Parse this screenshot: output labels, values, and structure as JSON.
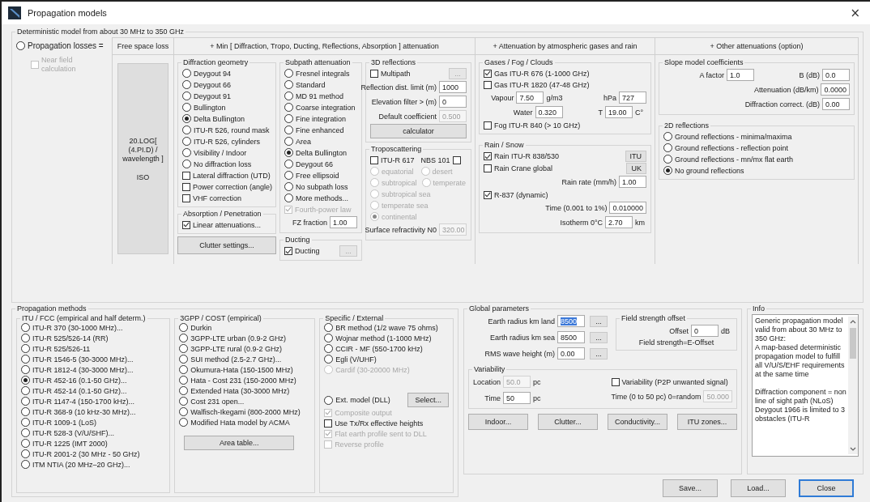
{
  "window": {
    "title": "Propagation models",
    "close": "×"
  },
  "deterministic": {
    "title": "Deterministic model from about 30 MHz to 350 GHz",
    "losses": {
      "kind": "radio",
      "label": "Propagation losses =",
      "selected": false
    },
    "near_field": {
      "kind": "check",
      "label": "Near field calculation",
      "checked": false,
      "disabled": true
    },
    "columns": [
      {
        "kind": "formula",
        "header": "Free space loss",
        "formula": "20.LOG[ (4.PI.D) / wavelength ]",
        "note": "ISO"
      },
      {
        "kind": "stacks",
        "header": "+ Min [ Diffraction, Tropo, Ducting, Reflections, Absorption ] attenuation",
        "stacks": [
          [
            {
              "kind": "group",
              "title": "Diffraction geometry",
              "items": [
                {
                  "kind": "radio",
                  "label": "Deygout 94",
                  "selected": false
                },
                {
                  "kind": "radio",
                  "label": "Deygout 66",
                  "selected": false
                },
                {
                  "kind": "radio",
                  "label": "Deygout 91",
                  "selected": false
                },
                {
                  "kind": "radio",
                  "label": "Bullington",
                  "selected": false
                },
                {
                  "kind": "radio",
                  "label": "Delta Bullington",
                  "selected": true
                },
                {
                  "kind": "radio",
                  "label": "ITU-R 526, round mask",
                  "selected": false
                },
                {
                  "kind": "radio",
                  "label": "ITU-R 526, cylinders",
                  "selected": false
                },
                {
                  "kind": "radio",
                  "label": "Visibility / Indoor",
                  "selected": false
                },
                {
                  "kind": "radio",
                  "label": "No diffraction loss",
                  "selected": false
                },
                {
                  "kind": "check",
                  "label": "Lateral diffraction (UTD)",
                  "checked": false
                },
                {
                  "kind": "check",
                  "label": "Power correction (angle)",
                  "checked": false
                },
                {
                  "kind": "check",
                  "label": "VHF correction",
                  "checked": false
                }
              ]
            },
            {
              "kind": "group",
              "title": "Absorption / Penetration",
              "items": [
                {
                  "kind": "check",
                  "label": "Linear attenuations...",
                  "checked": true
                }
              ]
            },
            {
              "kind": "button",
              "label": "Clutter settings..."
            }
          ],
          [
            {
              "kind": "group",
              "title": "Subpath attenuation",
              "items": [
                {
                  "kind": "radio",
                  "label": "Fresnel integrals",
                  "selected": false,
                  "disabled": false
                },
                {
                  "kind": "radio",
                  "label": "Standard",
                  "selected": false,
                  "disabled": false
                },
                {
                  "kind": "radio",
                  "label": "MD 91 method",
                  "selected": false,
                  "disabled": false
                },
                {
                  "kind": "radio",
                  "label": "Coarse integration",
                  "selected": false,
                  "disabled": false
                },
                {
                  "kind": "radio",
                  "label": "Fine integration",
                  "selected": false,
                  "disabled": false
                },
                {
                  "kind": "radio",
                  "label": "Fine enhanced",
                  "selected": false,
                  "disabled": false
                },
                {
                  "kind": "radio",
                  "label": "Area",
                  "selected": false,
                  "disabled": false
                },
                {
                  "kind": "radio",
                  "label": "Delta Bullington",
                  "selected": true,
                  "disabled": false
                },
                {
                  "kind": "radio",
                  "label": "Deygout 66",
                  "selected": false,
                  "disabled": false
                },
                {
                  "kind": "radio",
                  "label": "Free ellipsoid",
                  "selected": false,
                  "disabled": false
                },
                {
                  "kind": "radio",
                  "label": "No subpath loss",
                  "selected": false,
                  "disabled": false
                },
                {
                  "kind": "radio",
                  "label": "More methods...",
                  "selected": false,
                  "disabled": false
                },
                {
                  "kind": "check",
                  "label": "Fourth-power law",
                  "checked": true,
                  "disabled": true
                },
                {
                  "kind": "field",
                  "label": "FZ fraction",
                  "value": "1.00",
                  "disabled": false
                }
              ]
            },
            {
              "kind": "group",
              "title": "Ducting",
              "items": [
                {
                  "kind": "row",
                  "items": [
                    {
                      "kind": "check",
                      "label": "Ducting",
                      "checked": true,
                      "disabled": false
                    },
                    {
                      "kind": "mini",
                      "label": "...",
                      "disabled": true
                    }
                  ]
                }
              ]
            }
          ],
          [
            {
              "kind": "group",
              "title": "3D reflections",
              "items": [
                {
                  "kind": "row",
                  "items": [
                    {
                      "kind": "check",
                      "label": "Multipath",
                      "checked": false,
                      "disabled": false
                    },
                    {
                      "kind": "mini",
                      "label": "...",
                      "disabled": true
                    }
                  ]
                },
                {
                  "kind": "field",
                  "label": "Reflection dist. limit (m)",
                  "value": "1000",
                  "disabled": false
                },
                {
                  "kind": "field",
                  "label": "Elevation filter > (m)",
                  "value": "0",
                  "disabled": false
                },
                {
                  "kind": "field",
                  "label": "Default coefficient",
                  "value": "0.500",
                  "disabled": true
                },
                {
                  "kind": "button",
                  "label": "calculator"
                }
              ]
            },
            {
              "kind": "group",
              "title": "Troposcattering",
              "items": [
                {
                  "kind": "row",
                  "items": [
                    {
                      "kind": "check",
                      "label": "ITU-R 617",
                      "checked": false,
                      "disabled": false
                    },
                    {
                      "kind": "check",
                      "label": "NBS 101",
                      "checked": false,
                      "disabled": false,
                      "label_first": true
                    }
                  ]
                },
                {
                  "kind": "row",
                  "items": [
                    {
                      "kind": "radio",
                      "label": "equatorial",
                      "selected": false,
                      "disabled": true
                    },
                    {
                      "kind": "radio",
                      "label": "desert",
                      "selected": false,
                      "disabled": true
                    }
                  ]
                },
                {
                  "kind": "row",
                  "items": [
                    {
                      "kind": "radio",
                      "label": "subtropical",
                      "selected": false,
                      "disabled": true
                    },
                    {
                      "kind": "radio",
                      "label": "temperate",
                      "selected": false,
                      "disabled": true
                    }
                  ]
                },
                {
                  "kind": "radio",
                  "label": "subtropical sea",
                  "selected": false,
                  "disabled": true
                },
                {
                  "kind": "radio",
                  "label": "temperate sea",
                  "selected": false,
                  "disabled": true
                },
                {
                  "kind": "radio",
                  "label": "continental",
                  "selected": true,
                  "disabled": true
                },
                {
                  "kind": "field",
                  "label": "Surface refractivity N0",
                  "value": "320.00",
                  "disabled": true
                }
              ]
            }
          ]
        ]
      },
      {
        "kind": "stacks",
        "header": "+ Attenuation by atmospheric gases and rain",
        "stacks": [
          [
            {
              "kind": "group",
              "title": "Gases / Fog / Clouds",
              "items": [
                {
                  "kind": "check",
                  "label": "Gas ITU-R 676 (1-1000 GHz)",
                  "checked": true
                },
                {
                  "kind": "check",
                  "label": "Gas ITU-R 1820 (47-48 GHz)",
                  "checked": false
                },
                {
                  "kind": "row",
                  "items": [
                    {
                      "kind": "field",
                      "label": "Vapour",
                      "value": "7.50",
                      "unit": "g/m3"
                    },
                    {
                      "kind": "field",
                      "label": "hPa",
                      "value": "727"
                    }
                  ]
                },
                {
                  "kind": "row",
                  "items": [
                    {
                      "kind": "field",
                      "label": "Water",
                      "value": "0.320"
                    },
                    {
                      "kind": "field",
                      "label": "T",
                      "value": "19.00",
                      "unit": "C°"
                    }
                  ]
                },
                {
                  "kind": "check",
                  "label": "Fog ITU-R 840 (> 10 GHz)",
                  "checked": false
                }
              ]
            },
            {
              "kind": "group",
              "title": "Rain / Snow",
              "items": [
                {
                  "kind": "row",
                  "items": [
                    {
                      "kind": "check",
                      "label": "Rain ITU-R 838/530",
                      "checked": true
                    },
                    {
                      "kind": "mini",
                      "label": "ITU"
                    }
                  ]
                },
                {
                  "kind": "row",
                  "items": [
                    {
                      "kind": "check",
                      "label": "Rain Crane global",
                      "checked": false
                    },
                    {
                      "kind": "mini",
                      "label": "UK"
                    }
                  ]
                },
                {
                  "kind": "field",
                  "label": "Rain rate (mm/h)",
                  "value": "1.00"
                },
                {
                  "kind": "row",
                  "items": [
                    {
                      "kind": "check",
                      "label": "R-837 (dynamic)",
                      "checked": true
                    }
                  ]
                },
                {
                  "kind": "field",
                  "label": "Time (0.001 to 1%)",
                  "value": "0.010000"
                },
                {
                  "kind": "field",
                  "label": "Isotherm 0°C",
                  "value": "2.70",
                  "unit": "km"
                }
              ]
            }
          ]
        ]
      },
      {
        "kind": "stacks",
        "header": "+ Other attenuations (option)",
        "stacks": [
          [
            {
              "kind": "group",
              "title": "Slope model coefficients",
              "items": [
                {
                  "kind": "row",
                  "items": [
                    {
                      "kind": "field",
                      "label": "A factor",
                      "value": "1.0"
                    },
                    {
                      "kind": "field",
                      "label": "B (dB)",
                      "value": "0.0"
                    }
                  ]
                },
                {
                  "kind": "field",
                  "label": "Attenuation (dB/km)",
                  "value": "0.0000"
                },
                {
                  "kind": "field",
                  "label": "Diffraction correct. (dB)",
                  "value": "0.00"
                }
              ]
            },
            {
              "kind": "group",
              "title": "2D reflections",
              "items": [
                {
                  "kind": "radio",
                  "label": "Ground reflections - minima/maxima",
                  "selected": false
                },
                {
                  "kind": "radio",
                  "label": "Ground reflections - reflection point",
                  "selected": false
                },
                {
                  "kind": "radio",
                  "label": "Ground reflections - mn/mx flat earth",
                  "selected": false
                },
                {
                  "kind": "radio",
                  "label": "No ground reflections",
                  "selected": true
                }
              ]
            }
          ]
        ]
      }
    ]
  },
  "methods": {
    "title": "Propagation methods",
    "groups": [
      {
        "kind": "group",
        "title": "ITU / FCC (empirical and half determ.)",
        "items": [
          {
            "kind": "radio",
            "label": "ITU-R 370 (30-1000 MHz)...",
            "selected": false
          },
          {
            "kind": "radio",
            "label": "ITU-R 525/526-14 (RR)",
            "selected": false
          },
          {
            "kind": "radio",
            "label": "ITU-R 525/526-11",
            "selected": false
          },
          {
            "kind": "radio",
            "label": "ITU-R 1546-5 (30-3000 MHz)...",
            "selected": false
          },
          {
            "kind": "radio",
            "label": "ITU-R 1812-4 (30-3000 MHz)...",
            "selected": false
          },
          {
            "kind": "radio",
            "label": "ITU-R 452-16 (0.1-50 GHz)...",
            "selected": true
          },
          {
            "kind": "radio",
            "label": "ITU-R 452-14 (0.1-50 GHz)...",
            "selected": false
          },
          {
            "kind": "radio",
            "label": "ITU-R 1147-4 (150-1700 kHz)...",
            "selected": false
          },
          {
            "kind": "radio",
            "label": "ITU-R 368-9 (10 kHz-30 MHz)...",
            "selected": false
          },
          {
            "kind": "radio",
            "label": "ITU-R 1009-1 (LoS)",
            "selected": false
          },
          {
            "kind": "radio",
            "label": "ITU-R 528-3 (V/U/SHF)...",
            "selected": false
          },
          {
            "kind": "radio",
            "label": "ITU-R 1225 (IMT 2000)",
            "selected": false
          },
          {
            "kind": "radio",
            "label": "ITU-R 2001-2 (30 MHz - 50 GHz)",
            "selected": false
          },
          {
            "kind": "radio",
            "label": "ITM NTIA (20 MHz–20 GHz)...",
            "selected": false
          }
        ]
      },
      {
        "kind": "group",
        "title": "3GPP / COST (empirical)",
        "items": [
          {
            "kind": "radio",
            "label": "Durkin",
            "selected": false
          },
          {
            "kind": "radio",
            "label": "3GPP-LTE urban (0.9-2 GHz)",
            "selected": false
          },
          {
            "kind": "radio",
            "label": "3GPP-LTE rural (0.9-2 GHz)",
            "selected": false
          },
          {
            "kind": "radio",
            "label": "SUI method (2.5-2.7 GHz)...",
            "selected": false
          },
          {
            "kind": "radio",
            "label": "Okumura-Hata (150-1500 MHz)",
            "selected": false
          },
          {
            "kind": "radio",
            "label": "Hata - Cost 231 (150-2000 MHz)",
            "selected": false
          },
          {
            "kind": "radio",
            "label": "Extended Hata (30-3000 MHz)",
            "selected": false
          },
          {
            "kind": "radio",
            "label": "Cost 231 open...",
            "selected": false
          },
          {
            "kind": "radio",
            "label": "Walfisch-Ikegami (800-2000 MHz)",
            "selected": false
          },
          {
            "kind": "radio",
            "label": "Modified Hata model by ACMA",
            "selected": false
          },
          {
            "kind": "button",
            "label": "Area table..."
          }
        ]
      },
      {
        "kind": "group",
        "title": "Specific / External",
        "items": [
          {
            "kind": "radio",
            "label": "BR method (1/2 wave 75 ohms)",
            "selected": false,
            "disabled": false
          },
          {
            "kind": "radio",
            "label": "Wojnar method (1-1000 MHz)",
            "selected": false,
            "disabled": false
          },
          {
            "kind": "radio",
            "label": "CCIR - MF (550-1700 kHz)",
            "selected": false,
            "disabled": false
          },
          {
            "kind": "radio",
            "label": "Egli (V/UHF)",
            "selected": false,
            "disabled": false
          },
          {
            "kind": "radio",
            "label": "Cardif (30-20000 MHz)",
            "selected": false,
            "disabled": true
          },
          {
            "kind": "row",
            "items": [
              {
                "kind": "radio",
                "label": "Ext. model (DLL)",
                "selected": false,
                "disabled": false
              },
              {
                "kind": "button",
                "label": "Select..."
              }
            ]
          },
          {
            "kind": "check",
            "label": "Composite output",
            "checked": true,
            "disabled": true
          },
          {
            "kind": "check",
            "label": "Use Tx/Rx effective heights",
            "checked": false,
            "disabled": false
          },
          {
            "kind": "check",
            "label": "Flat earth profile sent to DLL",
            "checked": true,
            "disabled": true
          },
          {
            "kind": "check",
            "label": "Reverse profile",
            "checked": false,
            "disabled": true
          }
        ]
      }
    ]
  },
  "global": {
    "kind": "group",
    "title": "Global parameters",
    "items": [
      {
        "kind": "row",
        "items": [
          {
            "kind": "stack",
            "items": [
              {
                "kind": "row",
                "items": [
                  {
                    "kind": "field",
                    "label": "Earth radius km land",
                    "value": "8500",
                    "highlighted": true
                  },
                  {
                    "kind": "mini",
                    "label": "..."
                  }
                ]
              },
              {
                "kind": "row",
                "items": [
                  {
                    "kind": "field",
                    "label": "Earth radius km sea",
                    "value": "8500",
                    "highlighted": false
                  },
                  {
                    "kind": "mini",
                    "label": "..."
                  }
                ]
              },
              {
                "kind": "row",
                "items": [
                  {
                    "kind": "field",
                    "label": "RMS wave height (m)",
                    "value": "0.00",
                    "highlighted": false
                  },
                  {
                    "kind": "mini",
                    "label": "..."
                  }
                ]
              }
            ]
          },
          {
            "kind": "group",
            "title": "Field strength offset",
            "items": [
              {
                "kind": "field",
                "label": "Offset",
                "value": "0",
                "unit": "dB"
              },
              {
                "kind": "text",
                "label": "Field strength=E-Offset"
              }
            ]
          }
        ]
      },
      {
        "kind": "group",
        "title": "Variability",
        "items": [
          {
            "kind": "row",
            "items": [
              {
                "kind": "stack",
                "items": [
                  {
                    "kind": "field",
                    "label": "Location",
                    "value": "50.0",
                    "unit": "pc",
                    "disabled": true
                  },
                  {
                    "kind": "field",
                    "label": "Time",
                    "value": "50",
                    "unit": "pc",
                    "disabled": false
                  }
                ]
              },
              {
                "kind": "stack",
                "items": [
                  {
                    "kind": "check",
                    "label": "Variability (P2P unwanted signal)",
                    "checked": false,
                    "disabled": false
                  },
                  {
                    "kind": "field",
                    "label": "Time (0 to 50 pc) 0=random",
                    "value": "50.000",
                    "disabled": true
                  }
                ]
              }
            ]
          }
        ]
      },
      {
        "kind": "row",
        "items": [
          {
            "kind": "button",
            "label": "Indoor..."
          },
          {
            "kind": "button",
            "label": "Clutter..."
          },
          {
            "kind": "button",
            "label": "Conductivity..."
          },
          {
            "kind": "button",
            "label": "ITU zones..."
          }
        ]
      }
    ]
  },
  "info": {
    "title": "Info",
    "lines": [
      "Generic propagation model valid from about 30 MHz to 350 GHz:",
      "A map-based deterministic propagation model to fulfill all V/U/S/EHF requirements at the same time",
      "Diffraction component = non line of sight path (NLoS)",
      "Deygout 1966 is limited to 3 obstacles (ITU-R"
    ]
  },
  "footer": [
    {
      "label": "Save...",
      "default": false
    },
    {
      "label": "Load...",
      "default": false
    },
    {
      "label": "Close",
      "default": true
    }
  ]
}
